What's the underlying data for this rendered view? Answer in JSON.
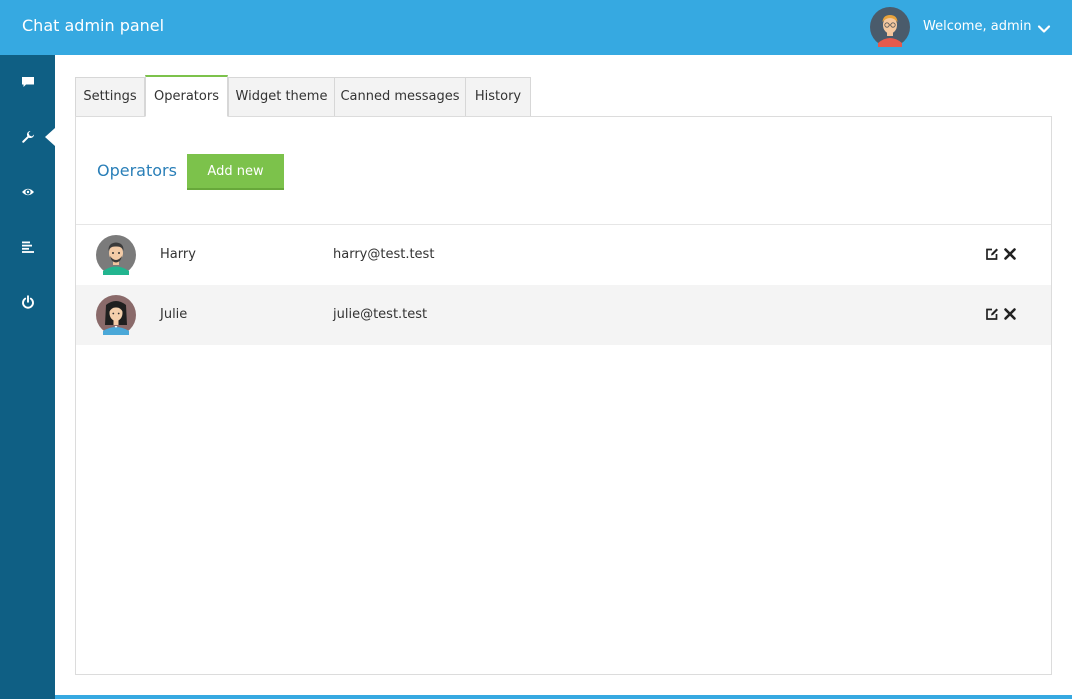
{
  "header": {
    "title": "Chat admin panel",
    "welcome": "Welcome, admin",
    "avatar_icon": "admin-avatar",
    "menu_icon": "chevron-down-icon"
  },
  "sidebar": {
    "items": [
      {
        "name": "chat",
        "icon": "chat-bubble-icon"
      },
      {
        "name": "settings",
        "icon": "wrench-icon",
        "active": true
      },
      {
        "name": "view",
        "icon": "eye-icon"
      },
      {
        "name": "history",
        "icon": "align-left-icon"
      },
      {
        "name": "logout",
        "icon": "power-icon"
      }
    ]
  },
  "tabs": [
    {
      "label": "Settings"
    },
    {
      "label": "Operators",
      "active": true
    },
    {
      "label": "Widget theme"
    },
    {
      "label": "Canned messages"
    },
    {
      "label": "History"
    }
  ],
  "operators_section": {
    "title": "Operators",
    "add_button": "Add new"
  },
  "operators": [
    {
      "name": "Harry",
      "email": "harry@test.test",
      "avatar": "male-avatar"
    },
    {
      "name": "Julie",
      "email": "julie@test.test",
      "avatar": "female-avatar"
    }
  ],
  "colors": {
    "header": "#36a9e1",
    "sidebar": "#0f5f84",
    "accent_green": "#7cc24b",
    "title_blue": "#2a7fb8"
  }
}
